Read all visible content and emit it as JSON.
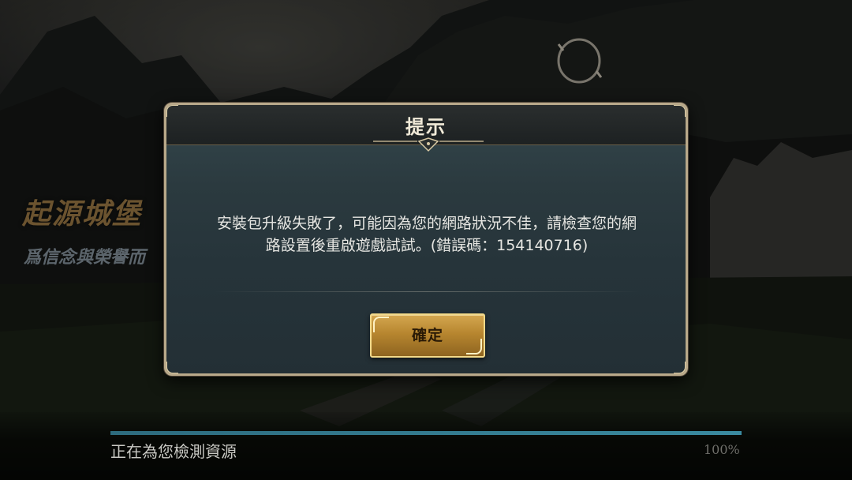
{
  "promo": {
    "title": "起源城堡",
    "subtitle": "爲信念與榮譽而"
  },
  "dialog": {
    "title": "提示",
    "message_line1": "安裝包升級失敗了，可能因為您的網路狀況不佳，請檢查您的網",
    "message_line2": "路設置後重啟遊戲試試。(錯誤碼：154140716)",
    "confirm_label": "確定"
  },
  "loading": {
    "status": "正在為您檢測資源",
    "percent_label": "100%",
    "progress": 1.0
  },
  "colors": {
    "accent_gold": "#d4a750",
    "progress_blue": "#3a8aa0",
    "dialog_bg": "#2b3a3f"
  },
  "icons": {
    "emblem": "ring-emblem-icon",
    "header_ornament": "ornament-icon"
  }
}
